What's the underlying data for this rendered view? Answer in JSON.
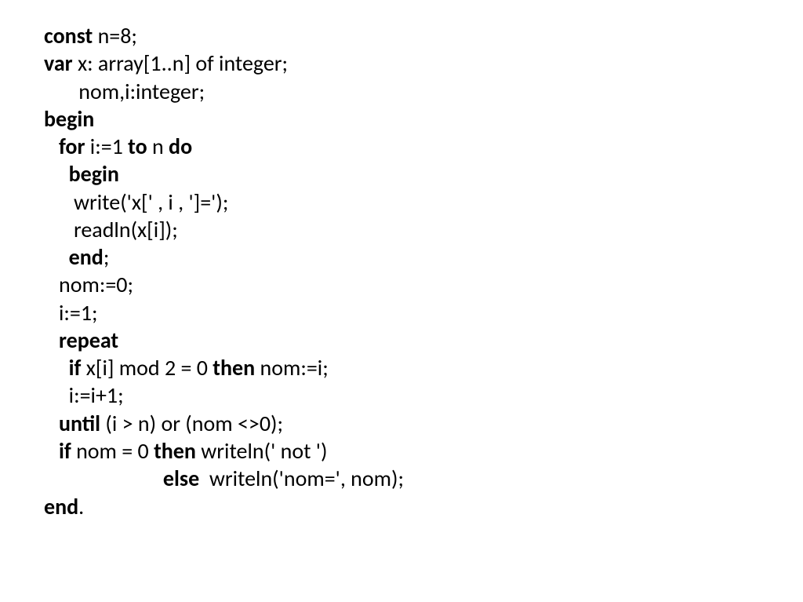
{
  "code": {
    "kw_const": "const",
    "l01_rest": " n=8;",
    "kw_var": "var",
    "l02_rest": " x: array[1..n] of integer;",
    "l03": "       nom,i:integer;",
    "kw_begin": "begin",
    "l05_lead": "   ",
    "kw_for": "for",
    "l05_mid": " i:=1 ",
    "kw_to": "to",
    "l05_mid2": " n ",
    "kw_do": "do",
    "l06_lead": "     ",
    "kw_begin2": "begin",
    "l07": "      write('x[' , i , ']=');",
    "l08": "      readln(x[i]);",
    "l09_lead": "     ",
    "kw_end": "end",
    "l09_rest": ";",
    "l10": "   nom:=0;",
    "l11": "   i:=1;",
    "l12_lead": "   ",
    "kw_repeat": "repeat",
    "l13_lead": "     ",
    "kw_if": "if",
    "l13_mid": " x[i] mod 2 = 0 ",
    "kw_then": "then",
    "l13_rest": " nom:=i;",
    "l14": "     i:=i+1;",
    "l15_lead": "   ",
    "kw_until": "until",
    "l15_rest": " (i > n) or (nom <>0);",
    "l16_lead": "   ",
    "kw_if2": "if",
    "l16_mid": " nom = 0 ",
    "kw_then2": "then",
    "l16_rest": " writeln(' not ')",
    "l17_lead": "                        ",
    "kw_else": "else",
    "l17_rest": "  writeln('nom=', nom);",
    "kw_end2": "end",
    "l18_rest": "."
  }
}
